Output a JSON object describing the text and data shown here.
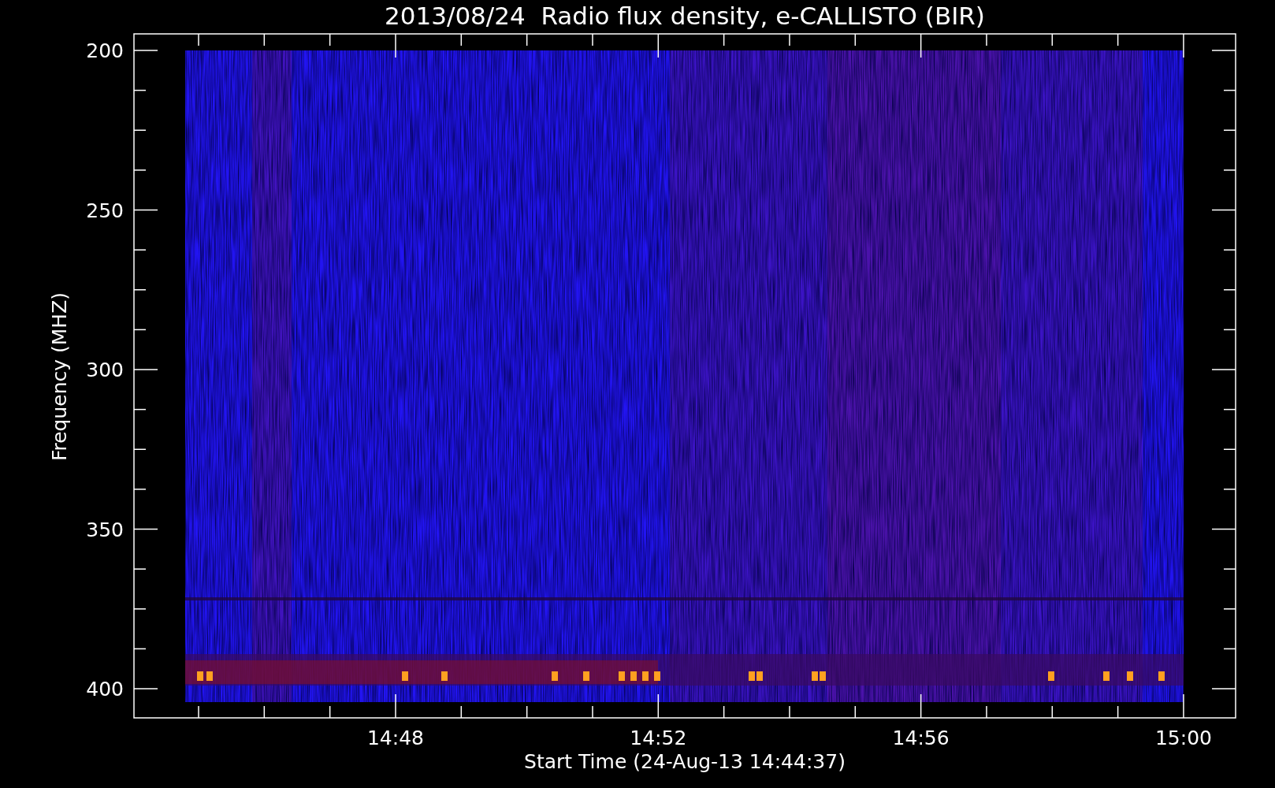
{
  "title": "2013/08/24  Radio flux density, e-CALLISTO (BIR)",
  "y_axis": {
    "label": "Frequency (MHZ)",
    "ticks": [
      "200",
      "250",
      "300",
      "350",
      "400"
    ]
  },
  "x_axis": {
    "label": "Start Time (24-Aug-13 14:44:37)",
    "ticks": [
      "14:48",
      "14:52",
      "14:56",
      "15:00"
    ]
  }
}
